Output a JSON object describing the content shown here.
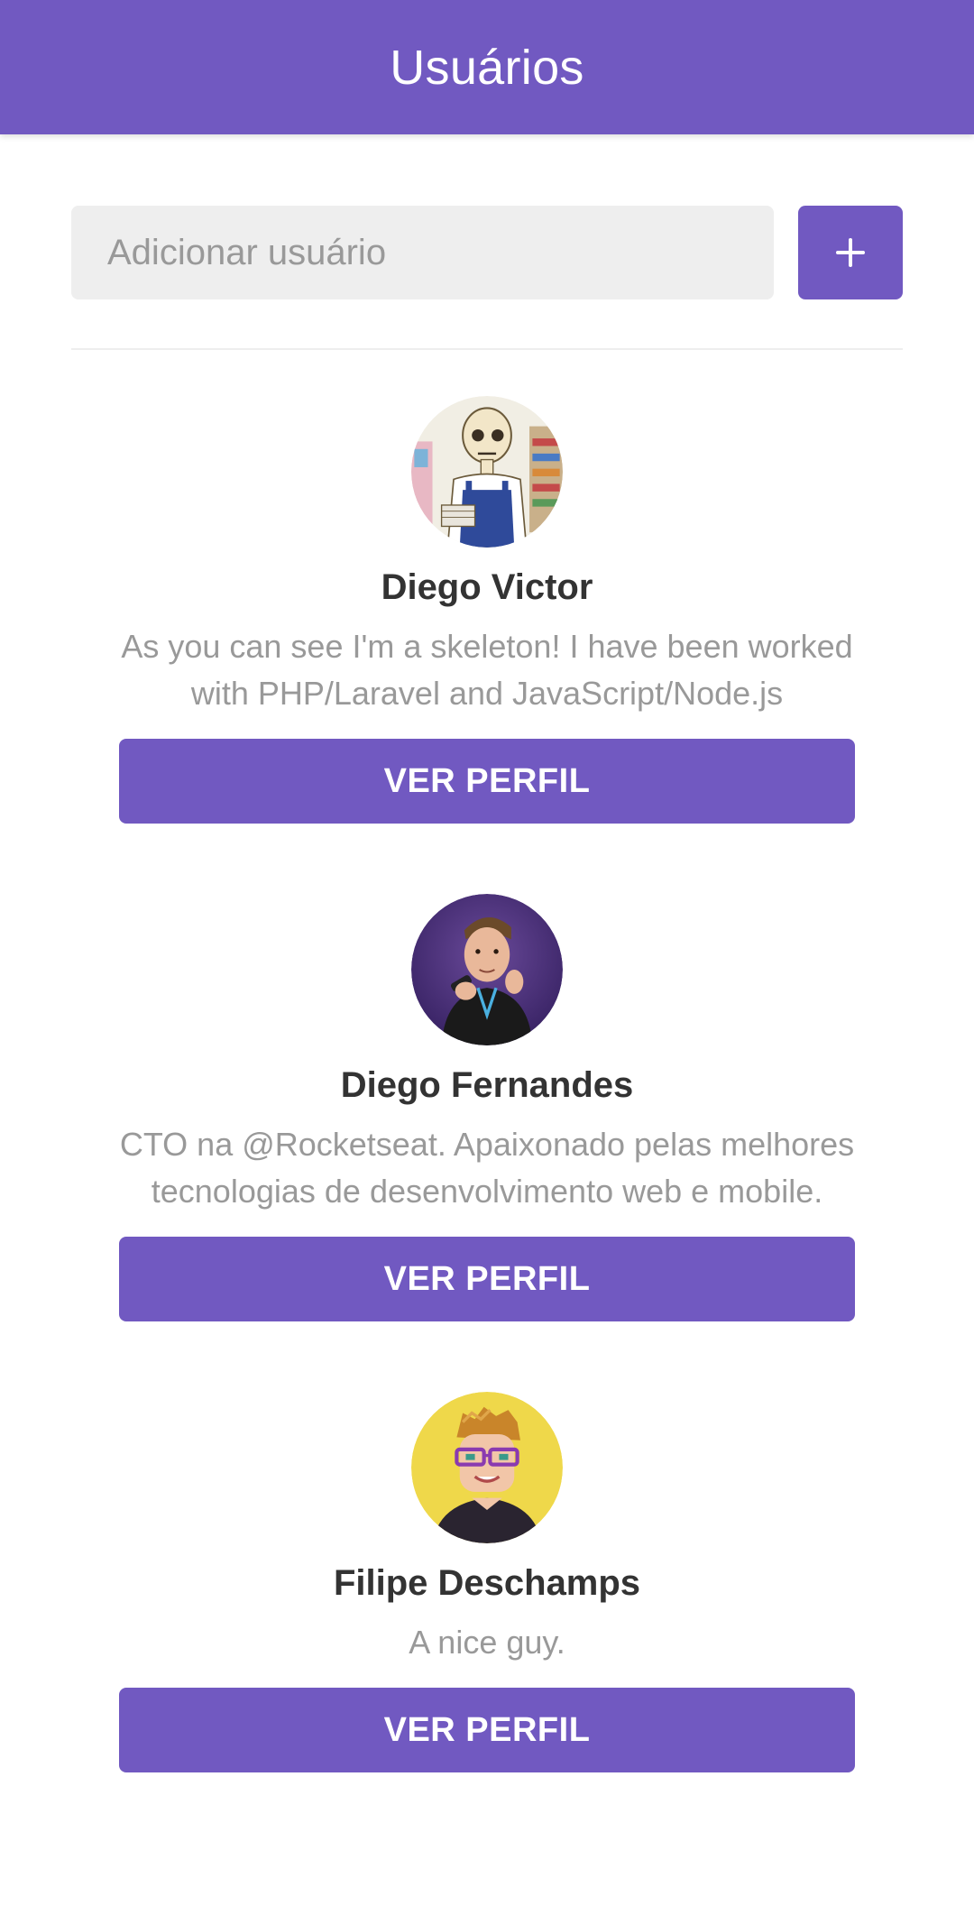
{
  "header": {
    "title": "Usuários"
  },
  "form": {
    "placeholder": "Adicionar usuário",
    "value": "",
    "add_icon": "plus-icon"
  },
  "users": [
    {
      "name": "Diego Victor",
      "bio": "As you can see I'm a skeleton! I have been worked with PHP/Laravel and JavaScript/Node.js",
      "button_label": "VER PERFIL",
      "avatar": "skeleton-illustration"
    },
    {
      "name": "Diego Fernandes",
      "bio": "CTO na @Rocketseat. Apaixonado pelas melhores tecnologias de desenvolvimento web e mobile.",
      "button_label": "VER PERFIL",
      "avatar": "man-with-microphone"
    },
    {
      "name": "Filipe Deschamps",
      "bio": "A nice guy.",
      "button_label": "VER PERFIL",
      "avatar": "pixel-art-man-with-glasses"
    }
  ],
  "colors": {
    "primary": "#7159c1",
    "input_bg": "#eeeeee",
    "name": "#333333",
    "bio": "#999999"
  }
}
